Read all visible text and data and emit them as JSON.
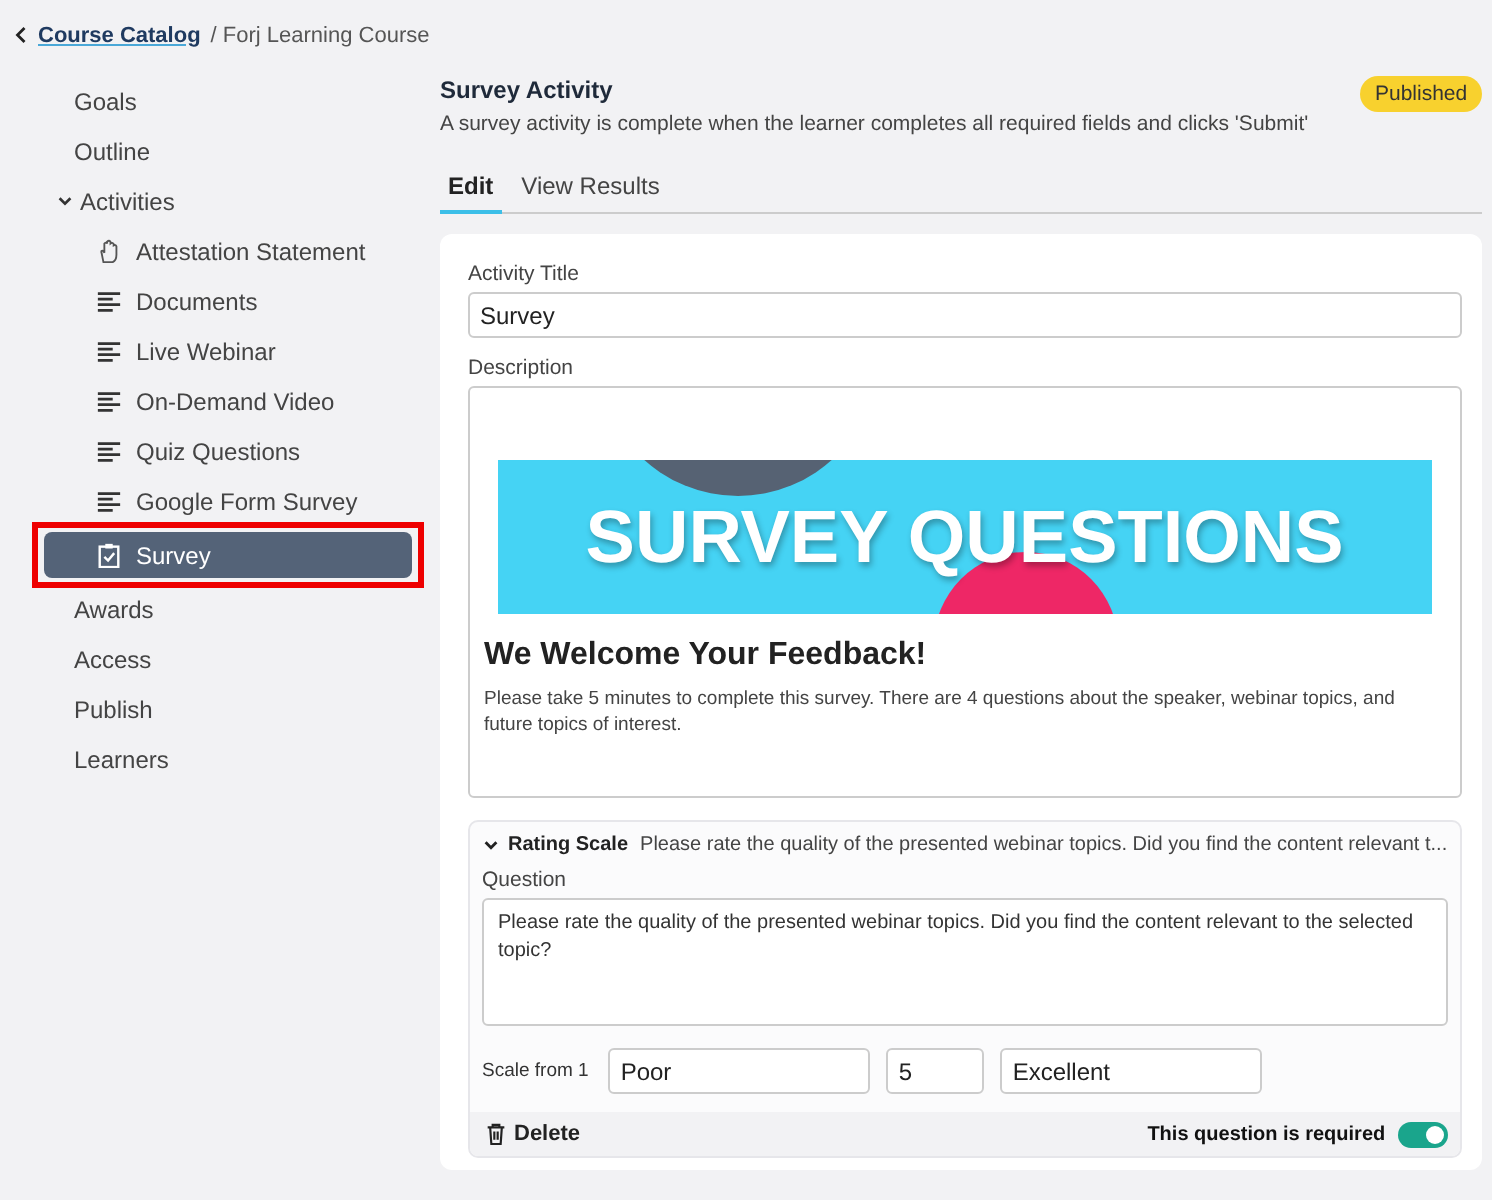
{
  "breadcrumb": {
    "back_link": "Course Catalog",
    "current": "/ Forj Learning Course"
  },
  "sidebar": {
    "items": [
      {
        "label": "Goals",
        "selected": false
      },
      {
        "label": "Outline",
        "selected": false
      },
      {
        "label": "Activities",
        "selected": false,
        "expanded": true,
        "children": [
          {
            "label": "Attestation Statement",
            "kind": "hand",
            "selected": false,
            "highlighted": false
          },
          {
            "label": "Documents",
            "kind": "lines",
            "selected": false,
            "highlighted": false
          },
          {
            "label": "Live Webinar",
            "kind": "lines",
            "selected": false,
            "highlighted": false
          },
          {
            "label": "On-Demand Video",
            "kind": "lines",
            "selected": false,
            "highlighted": false
          },
          {
            "label": "Quiz Questions",
            "kind": "lines",
            "selected": false,
            "highlighted": false
          },
          {
            "label": "Google Form Survey",
            "kind": "lines",
            "selected": false,
            "highlighted": false
          },
          {
            "label": "Survey",
            "kind": "clipboard",
            "selected": true,
            "highlighted": true
          }
        ]
      },
      {
        "label": "Awards",
        "selected": false
      },
      {
        "label": "Access",
        "selected": false
      },
      {
        "label": "Publish",
        "selected": false
      },
      {
        "label": "Learners",
        "selected": false
      }
    ]
  },
  "header": {
    "title": "Survey Activity",
    "description": "A survey activity is complete when the learner completes all required fields and clicks 'Submit'",
    "status": "Published"
  },
  "tabs": [
    {
      "label": "Edit",
      "selected": true
    },
    {
      "label": "View Results",
      "selected": false
    }
  ],
  "form": {
    "title_label": "Activity Title",
    "title_value": "Survey",
    "description_label": "Description",
    "description": {
      "banner_text": "SURVEY QUESTIONS",
      "heading": "We Welcome Your Feedback!",
      "paragraph": "Please take 5 minutes to complete this survey. There are 4 questions about the speaker, webinar topics, and future topics of interest."
    }
  },
  "question": {
    "type": "Rating Scale",
    "summary": "Please rate the quality of the presented webinar topics. Did you find the content relevant t...",
    "expanded": true,
    "question_label": "Question",
    "question_text": "Please rate the quality of the presented webinar topics. Did you find the content relevant to the selected topic?",
    "scale_label": "Scale from 1",
    "low_label": "Poor",
    "max_value": "5",
    "high_label": "Excellent",
    "delete_label": "Delete",
    "required_label": "This question is required",
    "required": true
  }
}
